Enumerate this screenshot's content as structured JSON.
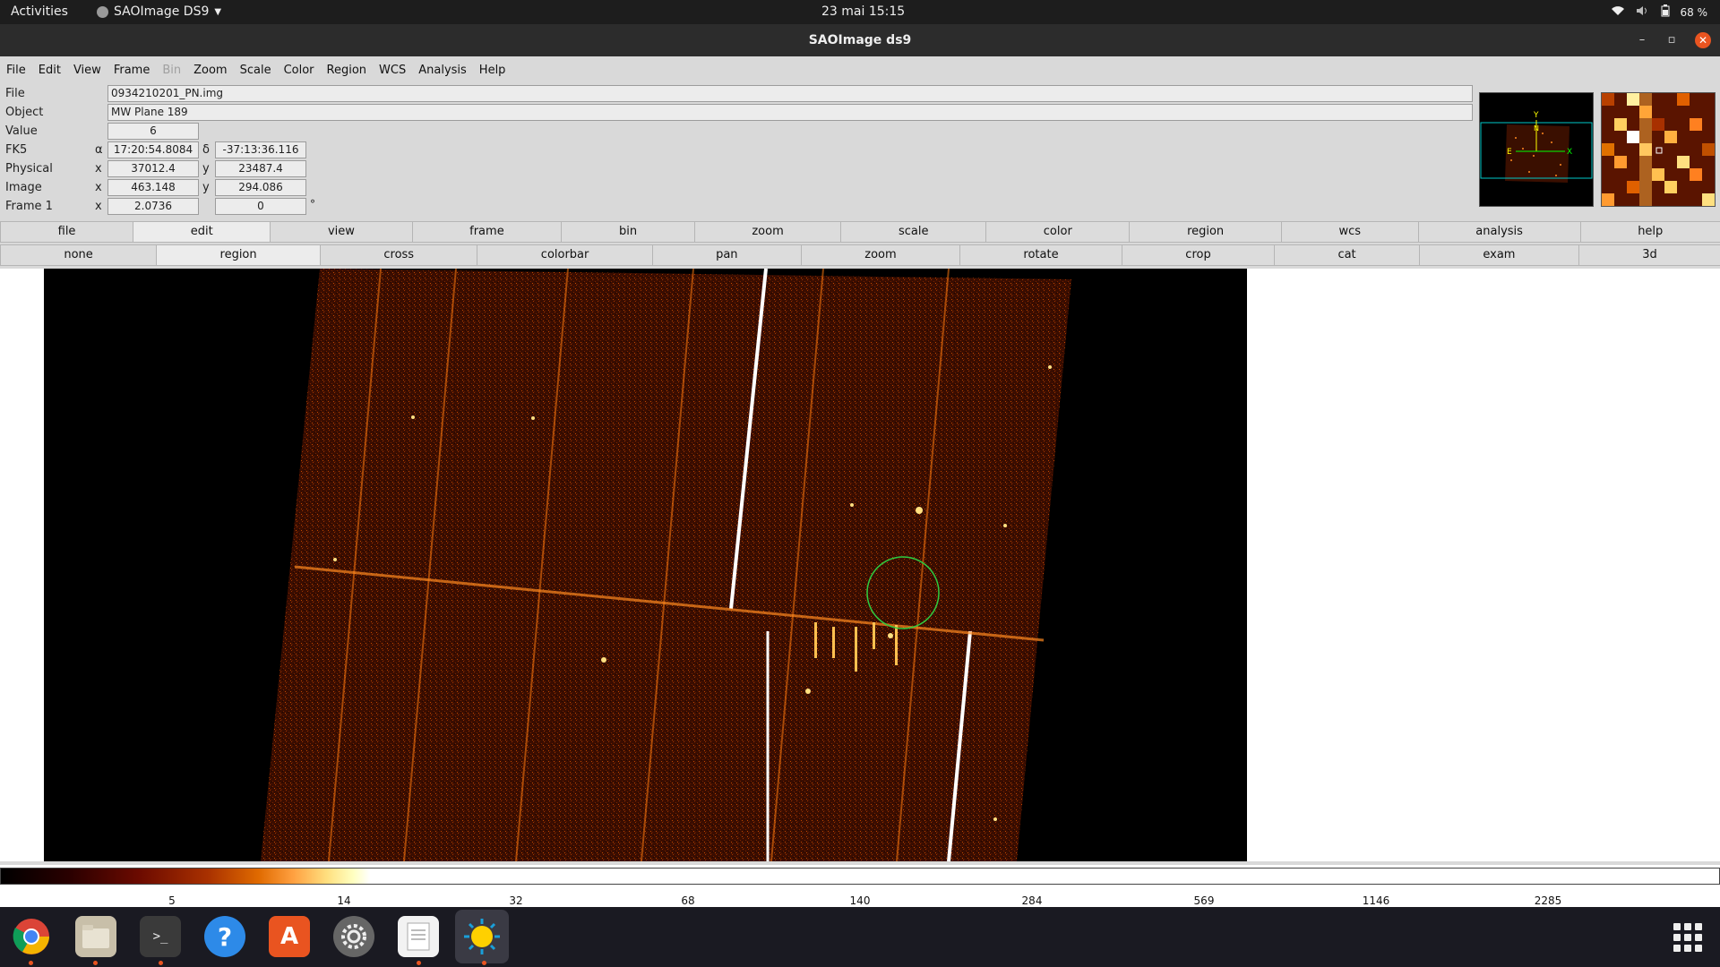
{
  "topbar": {
    "activities": "Activities",
    "app_name": "SAOImage DS9",
    "clock": "23 mai  15:15",
    "battery": "68 %"
  },
  "window": {
    "title": "SAOImage ds9"
  },
  "menubar": {
    "items": [
      "File",
      "Edit",
      "View",
      "Frame",
      "Bin",
      "Zoom",
      "Scale",
      "Color",
      "Region",
      "WCS",
      "Analysis",
      "Help"
    ],
    "disabled": [
      "Bin"
    ]
  },
  "info": {
    "file_label": "File",
    "file_value": "0934210201_PN.img",
    "object_label": "Object",
    "object_value": "MW Plane 189",
    "value_label": "Value",
    "value_value": "6",
    "fk5_label": "FK5",
    "fk5_alpha_sym": "α",
    "fk5_alpha": "17:20:54.8084",
    "fk5_delta_sym": "δ",
    "fk5_delta": "-37:13:36.116",
    "physical_label": "Physical",
    "physical_x_sym": "x",
    "physical_x": "37012.4",
    "physical_y_sym": "y",
    "physical_y": "23487.4",
    "image_label": "Image",
    "image_x_sym": "x",
    "image_x": "463.148",
    "image_y_sym": "y",
    "image_y": "294.086",
    "frame_label": "Frame 1",
    "frame_x_sym": "x",
    "frame_zoom": "2.0736",
    "frame_angle": "0",
    "deg": "°"
  },
  "buttonbar_main": {
    "items": [
      "file",
      "edit",
      "view",
      "frame",
      "bin",
      "zoom",
      "scale",
      "color",
      "region",
      "wcs",
      "analysis",
      "help"
    ],
    "active": "edit"
  },
  "buttonbar_edit": {
    "items": [
      "none",
      "region",
      "cross",
      "colorbar",
      "pan",
      "zoom",
      "rotate",
      "crop",
      "cat",
      "exam",
      "3d"
    ],
    "active": "region"
  },
  "colorbar": {
    "ticks": [
      "5",
      "14",
      "32",
      "68",
      "140",
      "284",
      "569",
      "1146",
      "2285"
    ],
    "tick_positions_note": ""
  },
  "colors": {
    "accent": "#e95420",
    "region_circle": "#2ecc40",
    "panner_box": "#00c8c8"
  },
  "dock": {
    "apps": [
      "chrome-icon",
      "files-icon",
      "terminal-icon",
      "help-icon",
      "software-icon",
      "settings-icon",
      "text-editor-icon",
      "ds9-icon"
    ]
  }
}
